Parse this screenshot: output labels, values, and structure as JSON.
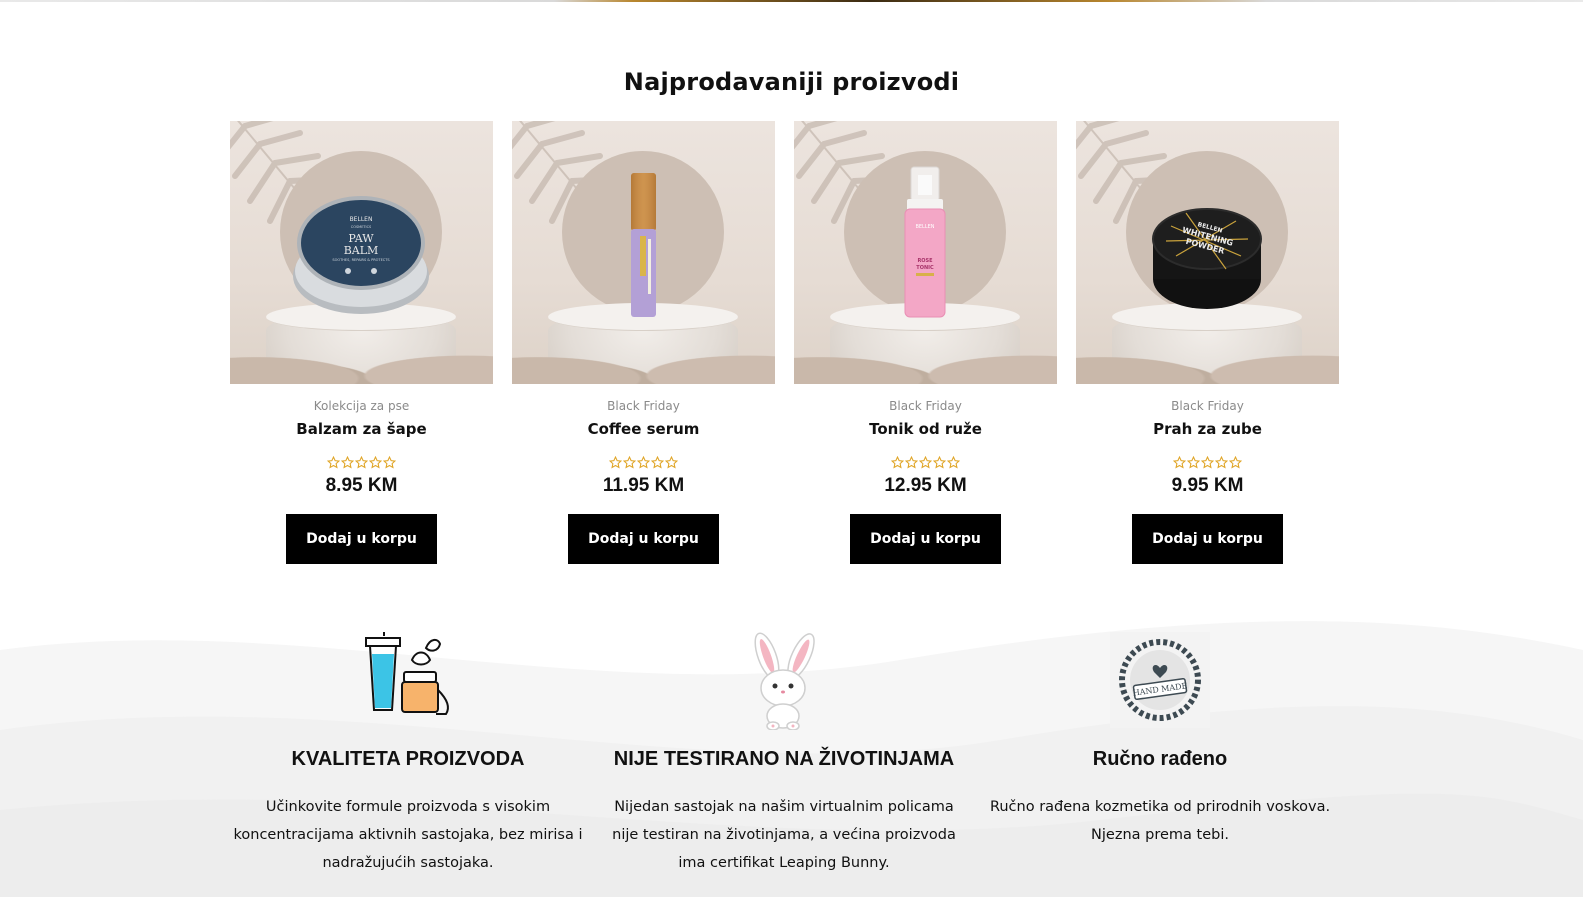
{
  "section_title": "Najprodavaniji proizvodi",
  "products": [
    {
      "category": "Kolekcija za pse",
      "name": "Balzam za šape",
      "price": "8.95 KM",
      "rating": 0,
      "button": "Dodaj u korpu",
      "package_text": [
        "BELLEN",
        "COSMETICS",
        "PAW",
        "BALM",
        "SOOTHES, REPAIRS & PROTECTS"
      ]
    },
    {
      "category": "Black Friday",
      "name": "Coffee serum",
      "price": "11.95 KM",
      "rating": 0,
      "button": "Dodaj u korpu",
      "package_text": []
    },
    {
      "category": "Black Friday",
      "name": "Tonik od ruže",
      "price": "12.95 KM",
      "rating": 0,
      "button": "Dodaj u korpu",
      "package_text": [
        "BELLEN",
        "ROSE",
        "TONIC"
      ]
    },
    {
      "category": "Black Friday",
      "name": "Prah za zube",
      "price": "9.95 KM",
      "rating": 0,
      "button": "Dodaj u korpu",
      "package_text": [
        "BELLEN",
        "WHITENING",
        "POWDER"
      ]
    }
  ],
  "features": [
    {
      "icon": "cosmetics-icon",
      "title": "KVALITETA PROIZVODA",
      "text": "Učinkovite formule proizvoda s visokim koncentracijama aktivnih sastojaka, bez mirisa i nadražujućih sastojaka."
    },
    {
      "icon": "bunny-icon",
      "title": "NIJE TESTIRANO NA ŽIVOTINJAMA",
      "text": "Nijedan sastojak na našim virtualnim policama nije testiran na životinjama, a većina proizvoda ima certifikat Leaping Bunny."
    },
    {
      "icon": "handmade-badge-icon",
      "title": "Ručno rađeno",
      "text": "Ručno rađena kozmetika od prirodnih voskova. Njezna prema tebi.",
      "badge_text": "HAND MADE"
    }
  ],
  "colors": {
    "star": "#e0a526",
    "button_bg": "#000000",
    "button_text": "#ffffff",
    "category_text": "#8a8a8a",
    "accent_gold": "#b8862e"
  }
}
